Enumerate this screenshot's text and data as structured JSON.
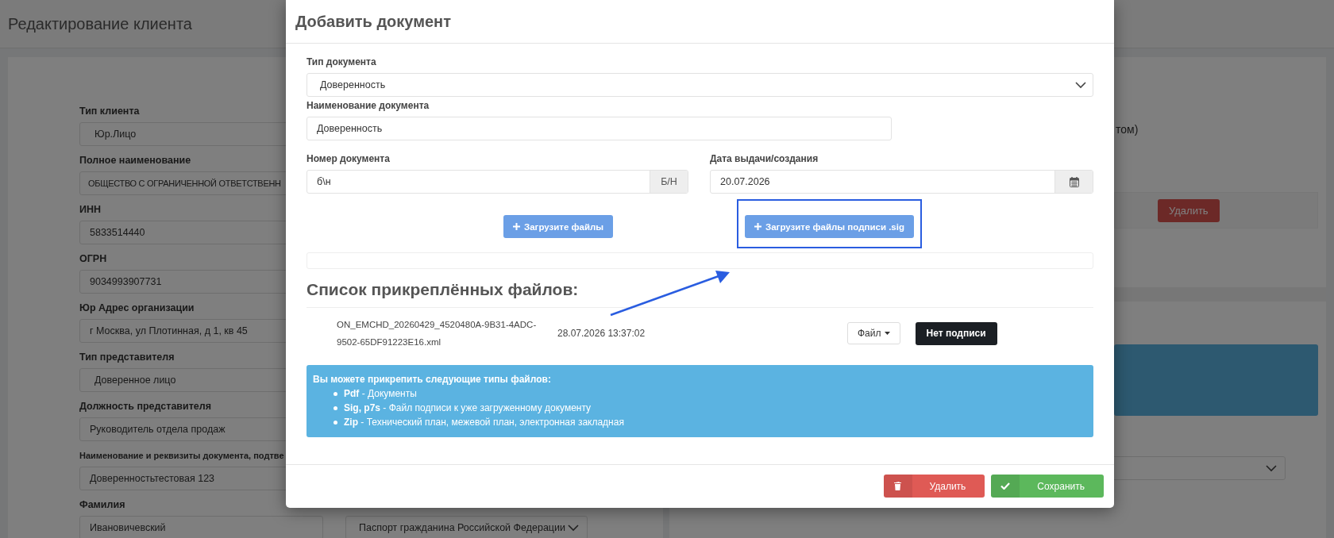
{
  "page": {
    "title": "Редактирование клиента",
    "client_form": [
      {
        "label": "Тип клиента",
        "value": "Юр.Лицо",
        "kind": "select"
      },
      {
        "label": "Полное наименование",
        "value": "ОБЩЕСТВО С ОГРАНИЧЕННОЙ ОТВЕТСТВЕНН",
        "kind": "text"
      },
      {
        "label": "ИНН",
        "value": "5833514440",
        "kind": "text"
      },
      {
        "label": "ОГРН",
        "value": "9034993907731",
        "kind": "text"
      },
      {
        "label": "Юр Адрес организации",
        "value": "г Москва, ул Плотинная, д 1, кв 45",
        "kind": "text"
      },
      {
        "label": "Тип представителя",
        "value": "Доверенное лицо",
        "kind": "select"
      },
      {
        "label": "Должность представителя",
        "value": "Руководитель отдела продаж",
        "kind": "text"
      },
      {
        "label": "Наименование и реквизиты документа, подтве",
        "value": "Доверенностьтестовая 123",
        "kind": "text"
      },
      {
        "label": "Фамилия",
        "value": "Ивановичевский",
        "kind": "text",
        "side_select": "Паспорт гражданина Российской Федерации"
      }
    ],
    "right_panel": {
      "text": "том)",
      "delete_button": "Удалить"
    }
  },
  "modal": {
    "title": "Добавить документ",
    "doc_type": {
      "label": "Тип документа",
      "value": "Доверенность"
    },
    "doc_name": {
      "label": "Наименование документа",
      "value": "Доверенность"
    },
    "doc_number": {
      "label": "Номер документа",
      "value": "б\\н",
      "addon": "Б/Н"
    },
    "doc_date": {
      "label": "Дата выдачи/создания",
      "value": "20.07.2026"
    },
    "upload_button": "Загрузите файлы",
    "upload_sig_button": "Загрузите файлы подписи .sig",
    "files_heading": "Список прикреплённых файлов:",
    "files": [
      {
        "name": "ON_EMCHD_20260429_4520480A-9B31-4ADC-9502-65DF91223E16.xml",
        "date": "28.07.2026 13:37:02",
        "file_button": "Файл",
        "signature_button": "Нет подписи"
      }
    ],
    "info": {
      "title": "Вы можете прикрепить следующие типы файлов:",
      "items": [
        "**Pdf** - Документы",
        "**Sig, p7s** - Файл подписи к уже загруженному документу",
        "**Zip** - Технический план, межевой план, электронная закладная"
      ]
    },
    "delete_button": "Удалить",
    "save_button": "Сохранить"
  }
}
